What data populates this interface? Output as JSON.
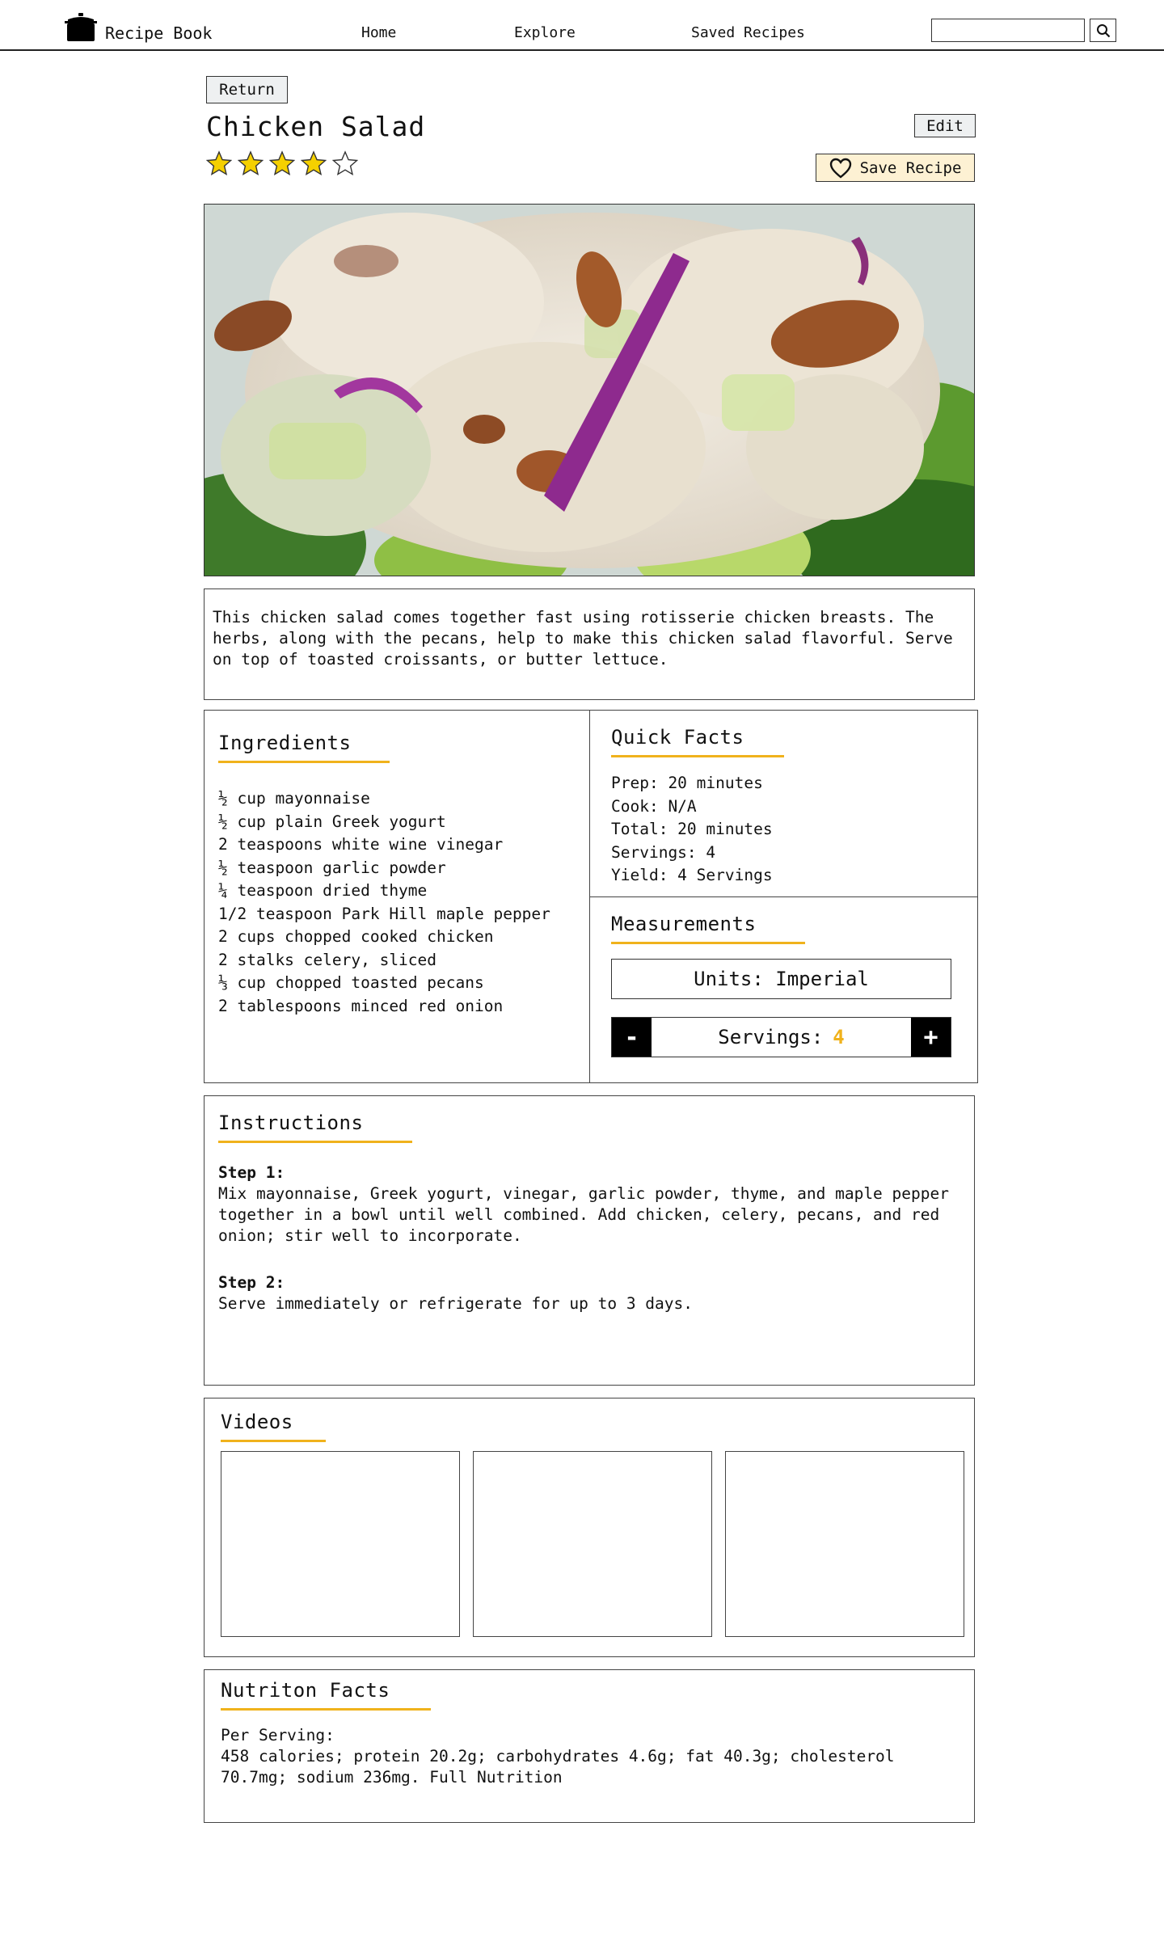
{
  "app": {
    "name": "Recipe Book"
  },
  "nav": {
    "links": [
      "Home",
      "Explore",
      "Saved Recipes"
    ]
  },
  "search": {
    "value": "",
    "placeholder": ""
  },
  "recipe": {
    "return_label": "Return",
    "edit_label": "Edit",
    "title": "Chicken Salad",
    "rating": 4,
    "rating_max": 5,
    "save_label": "Save Recipe",
    "description": "This chicken salad comes together fast using rotisserie chicken breasts. The herbs, along with the pecans, help to make this chicken salad flavorful. Serve on top of toasted croissants, or butter lettuce."
  },
  "ingredients": {
    "title": "Ingredients",
    "items": [
      "½ cup mayonnaise",
      "½ cup plain Greek yogurt",
      "2 teaspoons white wine vinegar",
      "½ teaspoon garlic powder",
      "¼ teaspoon dried thyme",
      "1/2 teaspoon Park Hill maple pepper",
      "2 cups chopped cooked chicken",
      "2 stalks celery, sliced",
      "⅓ cup chopped toasted pecans",
      "2 tablespoons minced red onion"
    ]
  },
  "quick_facts": {
    "title": "Quick Facts",
    "items": [
      "Prep: 20 minutes",
      "Cook: N/A",
      "Total: 20 minutes",
      "Servings: 4",
      "Yield: 4 Servings"
    ]
  },
  "measurements": {
    "title": "Measurements",
    "units_label": "Units: Imperial",
    "minus_label": "-",
    "plus_label": "+",
    "servings_label": "Servings:",
    "servings_value": "4"
  },
  "instructions": {
    "title": "Instructions",
    "steps": [
      {
        "label": "Step 1:",
        "text": "Mix mayonnaise, Greek yogurt, vinegar, garlic powder, thyme, and maple pepper together in a bowl until well combined. Add chicken, celery, pecans, and red onion; stir well to incorporate."
      },
      {
        "label": "Step 2:",
        "text": "Serve immediately or refrigerate for up to 3 days."
      }
    ]
  },
  "videos": {
    "title": "Videos",
    "count": 3
  },
  "nutrition": {
    "title": "Nutriton Facts",
    "per_serving": "Per Serving:",
    "text": "458 calories; protein 20.2g; carbohydrates 4.6g; fat 40.3g; cholesterol 70.7mg; sodium 236mg. Full Nutrition"
  },
  "colors": {
    "accent": "#f0b21c",
    "star": "#f5d000",
    "save_bg": "#fdf1d3",
    "button_bg": "#eef0f1"
  },
  "icons": {
    "logo": "cooking-pot-icon",
    "search": "search-icon",
    "heart": "heart-outline-icon",
    "star": "star-icon"
  }
}
